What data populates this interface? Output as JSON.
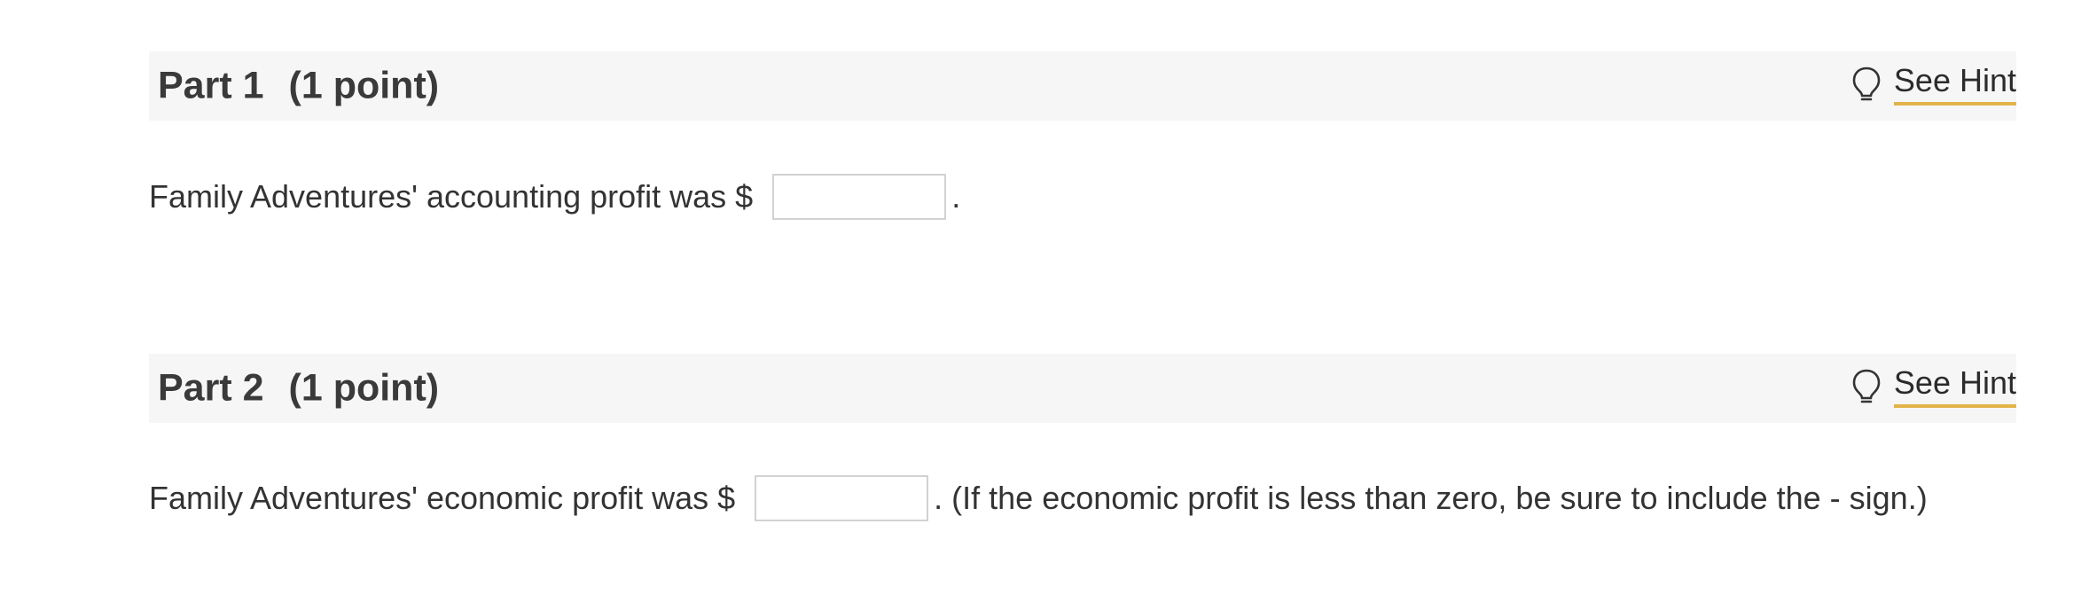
{
  "parts": [
    {
      "part_label": "Part 1",
      "points": "(1 point)",
      "hint_label": "See Hint",
      "prompt_before": "Family Adventures' accounting profit was $",
      "answer_value": "",
      "prompt_after": "."
    },
    {
      "part_label": "Part 2",
      "points": "(1 point)",
      "hint_label": "See Hint",
      "prompt_before": "Family Adventures' economic profit was $",
      "answer_value": "",
      "prompt_after": ". (If the economic profit is less than zero, be sure to include the - sign.)"
    }
  ],
  "icons": {
    "hint_icon": "lightbulb-icon"
  },
  "colors": {
    "header_bg": "#f6f6f6",
    "hint_underline": "#e3b34a",
    "input_border": "#d2d2d2"
  }
}
